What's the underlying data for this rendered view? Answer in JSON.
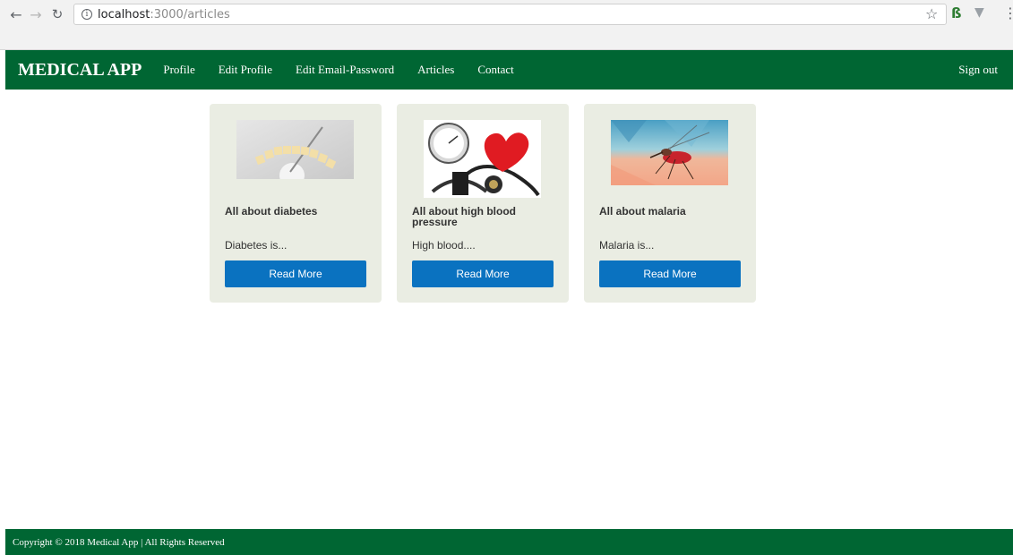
{
  "browser": {
    "url_host": "localhost",
    "url_path": ":3000/articles"
  },
  "navbar": {
    "brand": "MEDICAL APP",
    "links": [
      "Profile",
      "Edit Profile",
      "Edit Email-Password",
      "Articles",
      "Contact"
    ],
    "sign_out": "Sign out"
  },
  "articles": [
    {
      "title": "All about diabetes",
      "excerpt": "Diabetes is...",
      "button": "Read More"
    },
    {
      "title": "All about high blood pressure",
      "excerpt": "High blood....",
      "button": "Read More"
    },
    {
      "title": "All about malaria",
      "excerpt": "Malaria is...",
      "button": "Read More"
    }
  ],
  "footer": {
    "text": "Copyright © 2018 Medical App | All Rights Reserved"
  },
  "colors": {
    "navbar": "#006633",
    "card_bg": "#eaede3",
    "button": "#0a72c0"
  },
  "icons": [
    "back-arrow-icon",
    "forward-arrow-icon",
    "reload-icon",
    "info-icon",
    "star-icon",
    "extension-icon",
    "menu-dots-icon"
  ]
}
